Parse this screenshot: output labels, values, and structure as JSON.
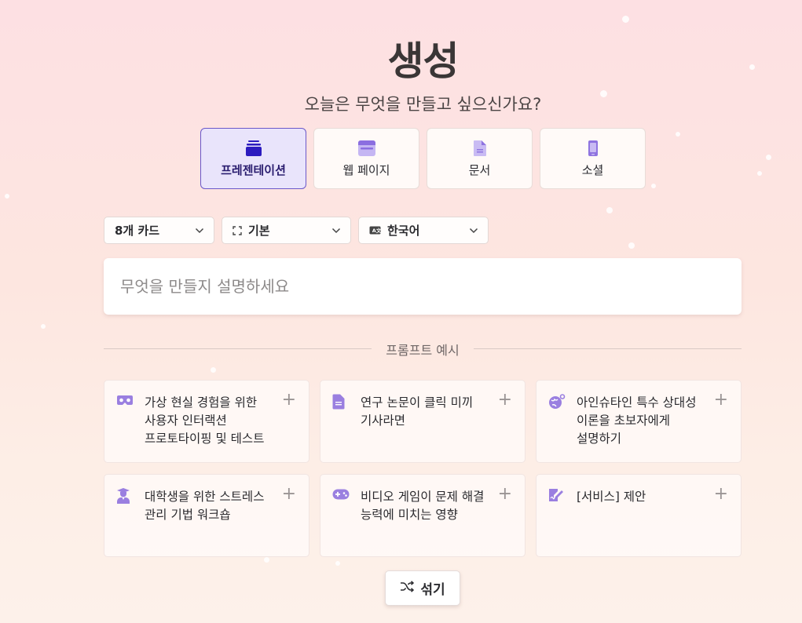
{
  "header": {
    "title": "생성",
    "subtitle": "오늘은 무엇을 만들고 싶으신가요?"
  },
  "types": [
    {
      "label": "프레젠테이션",
      "icon": "layers-icon",
      "active": true
    },
    {
      "label": "웹 페이지",
      "icon": "browser-window-icon",
      "active": false
    },
    {
      "label": "문서",
      "icon": "document-icon",
      "active": false
    },
    {
      "label": "소셜",
      "icon": "phone-icon",
      "active": false
    }
  ],
  "selects": {
    "cards": "8개 카드",
    "format": "기본",
    "language": "한국어",
    "language_badge": "A文"
  },
  "prompt": {
    "placeholder": "무엇을 만들지 설명하세요"
  },
  "examples": {
    "heading": "프롬프트 예시",
    "items": [
      {
        "text": "가상 현실 경험을 위한 사용자 인터랙션 프로토타이핑 및 테스트",
        "icon": "vr-headset-icon"
      },
      {
        "text": "연구 논문이 클릭 미끼 기사라면",
        "icon": "document-icon"
      },
      {
        "text": "아인슈타인 특수 상대성 이론을 초보자에게 설명하기",
        "icon": "globe-orbit-icon"
      },
      {
        "text": "대학생을 위한 스트레스 관리 기법 워크숍",
        "icon": "graduate-icon"
      },
      {
        "text": "비디오 게임이 문제 해결 능력에 미치는 영향",
        "icon": "gamepad-icon"
      },
      {
        "text": "[서비스] 제안",
        "icon": "signature-icon"
      }
    ],
    "add_symbol": "+"
  },
  "shuffle": {
    "label": "섞기",
    "icon": "shuffle-icon"
  },
  "colors": {
    "accent": "#6b58c9",
    "icon_purple": "#9a7fe0",
    "active_bg": "#e9e4fb"
  }
}
